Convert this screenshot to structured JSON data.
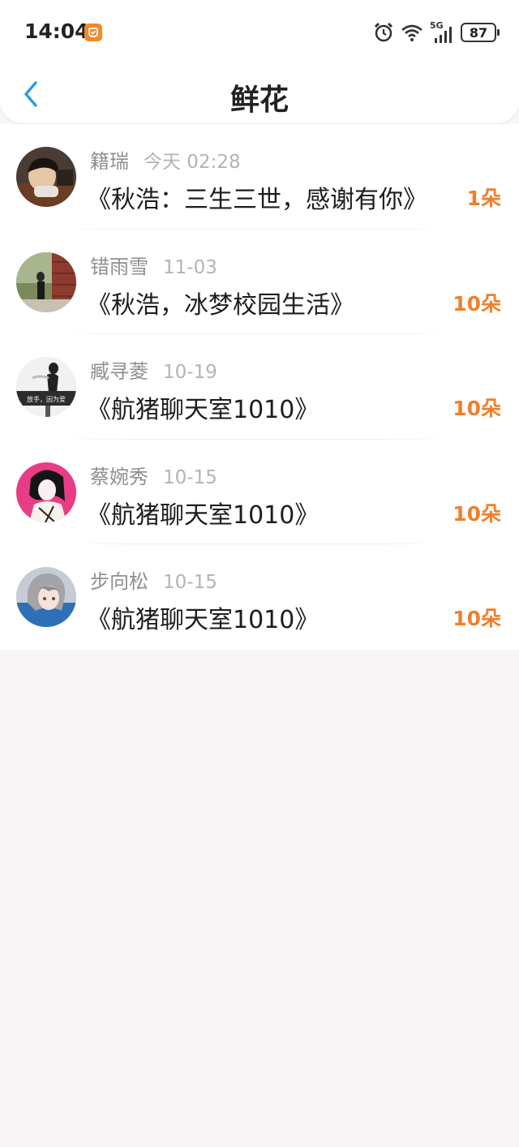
{
  "status_bar": {
    "time": "14:04",
    "network": "5G",
    "battery": "87"
  },
  "header": {
    "title": "鲜花"
  },
  "colors": {
    "accent_orange": "#f07f2b",
    "back_blue": "#2b9be8"
  },
  "items": [
    {
      "name": "籍瑞",
      "time": "今天 02:28",
      "title": "《秋浩：三生三世，感谢有你》",
      "count": "1朵"
    },
    {
      "name": "错雨雪",
      "time": "11-03",
      "title": "《秋浩，冰梦校园生活》",
      "count": "10朵"
    },
    {
      "name": "臧寻菱",
      "time": "10-19",
      "title": "《航猪聊天室1010》",
      "count": "10朵",
      "avatar_caption": "放手，因为爱"
    },
    {
      "name": "蔡婉秀",
      "time": "10-15",
      "title": "《航猪聊天室1010》",
      "count": "10朵"
    },
    {
      "name": "步向松",
      "time": "10-15",
      "title": "《航猪聊天室1010》",
      "count": "10朵"
    }
  ]
}
